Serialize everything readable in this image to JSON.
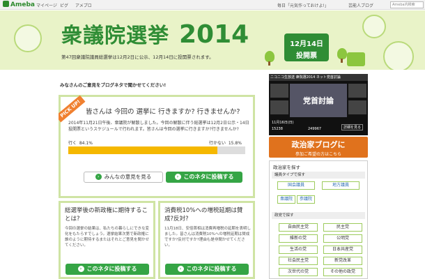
{
  "topbar": {
    "brand": "Ameba",
    "nav": [
      "マイページ",
      "ピグ",
      "アメプロ"
    ],
    "links": [
      "毎日「元気作っておけよ!」",
      "芸能人ブログ"
    ],
    "search_placeholder": "Ameba内検索"
  },
  "header": {
    "title": "衆議院選挙",
    "year": "2014",
    "subtitle": "第47回衆議院議員総選挙は12月2日に公示、12月14日に投開票されます。",
    "date_line1": "12月14日",
    "date_line2": "投開票"
  },
  "question_bar": "みなさんのご意見をブログネタで聞かせてください!",
  "main_card": {
    "ribbon": "PICK UP!",
    "heading": "皆さんは 今回の 選挙に 行きますか? 行きませんか?",
    "desc": "2014年11月21日午後、衆議院が解散しました。今回の解散に伴う総選挙は12月2日公示・14日投開票というスケジュールで行われます。皆さんは今回の選挙に行きますか?行きませんか?",
    "opt_go": "行く",
    "opt_go_pct": "84.1%",
    "opt_no": "行かない",
    "opt_no_pct": "15.8%",
    "go_fraction": 0.841,
    "btn_see": "みんなの意見を見る",
    "btn_post": "このネタに投稿する"
  },
  "card_left": {
    "title": "総選挙後の新政権に期待することは?",
    "desc": "今回の選挙の結果は、私たちの暮らしにできな変化をもたらすでしょう。選挙結果次第で新政権に誰のように期待するまたはそれとご意見を聞かせてください。",
    "btn": "このネタに投稿する"
  },
  "card_right": {
    "title": "消費税10%への増税延期は賛成?反対?",
    "desc": "11月18日、安倍首相は消費再増税の延期を表明しました。皆さんは消費税10%への増税延期は賛成ですか?反対ですか?理由も是非聞かせてください。",
    "btn": "このネタに投稿する"
  },
  "video": {
    "header": "ニコニコ生放送 衆院選2014 ネット党首討論",
    "main_label": "党首討論",
    "date_line": "11月16日(日)",
    "count1": "15238",
    "count2": "249967",
    "label_more": "詳細を見る"
  },
  "promo": {
    "line1": "政治家ブログに",
    "line2": "参加ご希望の方はこちら"
  },
  "sidebox": {
    "title": "政治家を探す",
    "sec_type": "議員タイプで探す",
    "type_buttons": [
      "国会議員",
      "地方議員"
    ],
    "chamber_buttons": [
      "衆議院",
      "参議院"
    ],
    "sec_party": "政党で探す",
    "parties": [
      "自由民主党",
      "民主党",
      "維新の党",
      "公明党",
      "生活の党",
      "日本共産党",
      "社会民主党",
      "新党改革",
      "次世代の党",
      "その他の政党"
    ]
  },
  "colors": {
    "accent_green": "#2f8d35",
    "button_green": "#35a545",
    "bar_yellow": "#f5b800",
    "promo_orange": "#e0721d"
  }
}
